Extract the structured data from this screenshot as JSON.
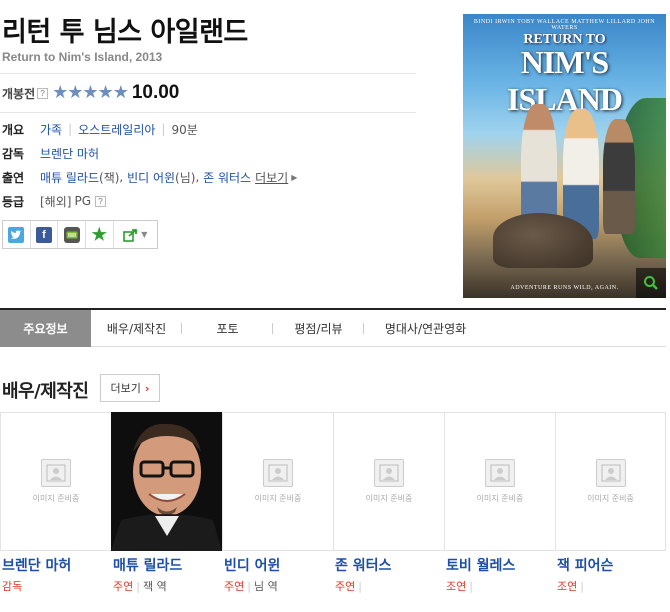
{
  "movie": {
    "title": "리턴 투 님스 아일랜드",
    "subtitle": "Return to Nim's Island, 2013"
  },
  "rating": {
    "label": "개봉전",
    "help": "?",
    "score": "10.00",
    "stars": 5
  },
  "info": {
    "overview_label": "개요",
    "genre": "가족",
    "country": "오스트레일리아",
    "runtime": "90분",
    "director_label": "감독",
    "director": "브렌단 마허",
    "cast_label": "출연",
    "cast_1": "매튜 릴라드",
    "cast_1_role": "(잭)",
    "cast_2": "빈디 어윈",
    "cast_2_role": "(님)",
    "cast_3": "존 워터스",
    "more": "더보기",
    "grade_label": "등급",
    "grade_region": "[해외]",
    "grade": "PG",
    "grade_help": "?"
  },
  "share": {
    "buttons": [
      "twitter-icon",
      "facebook-icon",
      "me2day-icon",
      "favorite-star-icon",
      "share-icon"
    ]
  },
  "poster": {
    "actors_line": "BINDI IRWIN   TOBY WALLACE   MATTHEW LILLARD   JOHN WATERS",
    "title_top": "RETURN TO",
    "title_main": "NIM'S ISLAND",
    "tagline": "ADVENTURE RUNS WILD, AGAIN."
  },
  "tabs": [
    {
      "label": "주요정보",
      "active": true
    },
    {
      "label": "배우/제작진",
      "active": false
    },
    {
      "label": "포토",
      "active": false
    },
    {
      "label": "평점/리뷰",
      "active": false
    },
    {
      "label": "명대사/연관영화",
      "active": false
    }
  ],
  "cast_section": {
    "title": "배우/제작진",
    "more": "더보기",
    "placeholder_text": "이미지 준비중",
    "people": [
      {
        "name": "브렌단 마허",
        "role": "감독",
        "character": ""
      },
      {
        "name": "매튜 릴라드",
        "role": "주연",
        "character": "잭 역"
      },
      {
        "name": "빈디 어윈",
        "role": "주연",
        "character": "님 역"
      },
      {
        "name": "존 워터스",
        "role": "주연",
        "character": ""
      },
      {
        "name": "토비 월레스",
        "role": "조연",
        "character": ""
      },
      {
        "name": "잭 피어슨",
        "role": "조연",
        "character": ""
      }
    ]
  },
  "colors": {
    "link": "#1d4fa8",
    "accent_red": "#e0382c",
    "star": "#6c8fbf",
    "active_tab": "#8c8c8c"
  }
}
